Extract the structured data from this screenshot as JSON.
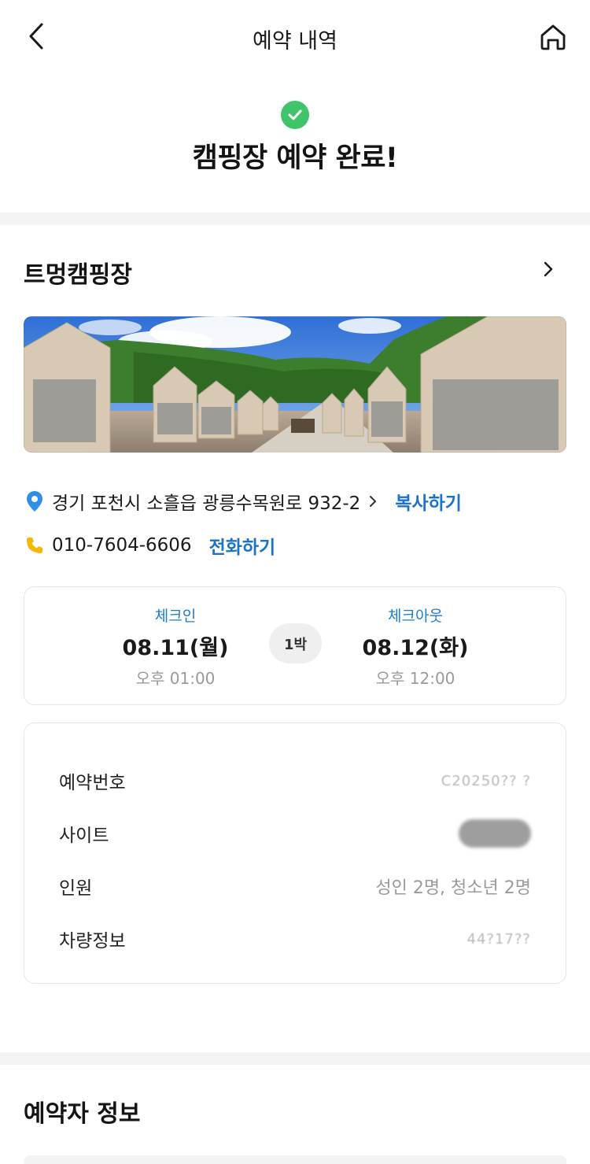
{
  "header": {
    "title": "예약 내역"
  },
  "status": {
    "title": "캠핑장 예약 완료!",
    "icon": "check-circle-icon",
    "color": "#3fc46a"
  },
  "campsite": {
    "name": "트멍캠핑장",
    "address": "경기 포천시 소흘읍 광릉수목원로 932-2",
    "copy_label": "복사하기",
    "phone": "010-7604-6606",
    "call_label": "전화하기",
    "accent_color": "#1a73c9"
  },
  "stay": {
    "checkin_label": "체크인",
    "checkin_date": "08.11(월)",
    "checkin_time": "오후 01:00",
    "nights": "1박",
    "checkout_label": "체크아웃",
    "checkout_date": "08.12(화)",
    "checkout_time": "오후 12:00"
  },
  "details": {
    "rows": [
      {
        "label": "예약번호",
        "value": "C2025?? (obscured)"
      },
      {
        "label": "사이트",
        "value": "(obscured)"
      },
      {
        "label": "인원",
        "value": "성인 2명, 청소년 2명"
      },
      {
        "label": "차량정보",
        "value": "(obscured)"
      }
    ]
  },
  "booker_section": {
    "title": "예약자 정보"
  }
}
